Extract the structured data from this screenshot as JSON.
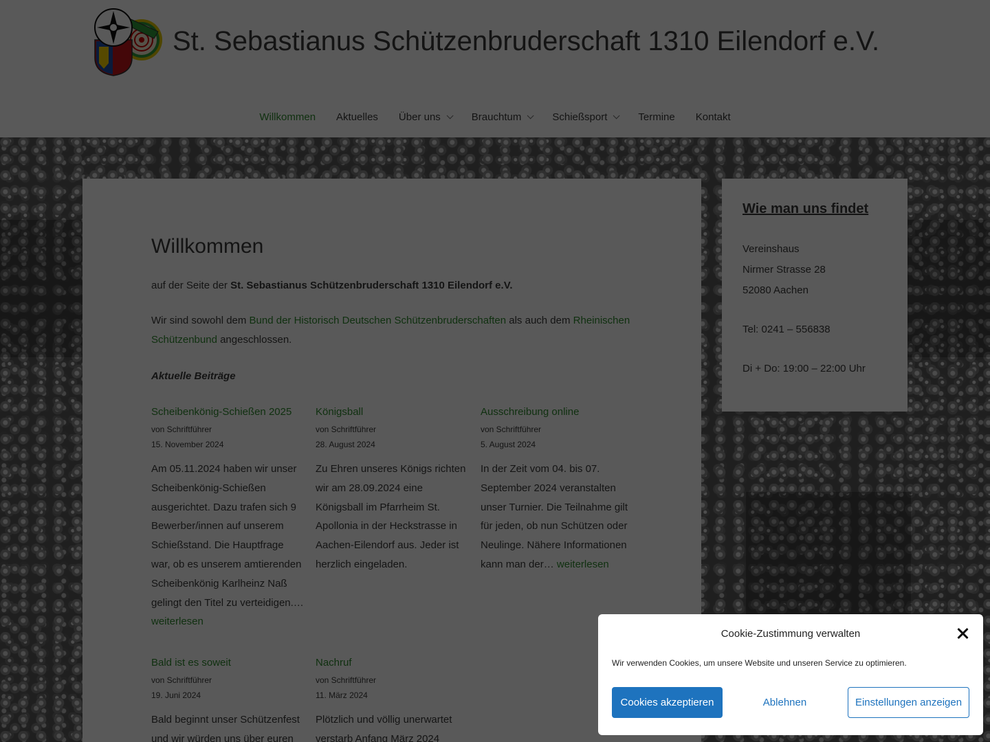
{
  "header": {
    "site_title": "St. Sebastianus Schützenbruderschaft 1310 Eilendorf e.V.",
    "logo_icon": "club-crest-icon"
  },
  "nav": {
    "items": [
      {
        "label": "Willkommen",
        "active": true,
        "has_submenu": false
      },
      {
        "label": "Aktuelles",
        "active": false,
        "has_submenu": false
      },
      {
        "label": "Über uns",
        "active": false,
        "has_submenu": true
      },
      {
        "label": "Brauchtum",
        "active": false,
        "has_submenu": true
      },
      {
        "label": "Schießsport",
        "active": false,
        "has_submenu": true
      },
      {
        "label": "Termine",
        "active": false,
        "has_submenu": false
      },
      {
        "label": "Kontakt",
        "active": false,
        "has_submenu": false
      }
    ]
  },
  "main": {
    "title": "Willkommen",
    "intro_prefix": "auf der Seite der ",
    "intro_bold": "St. Sebastianus Schützenbruderschaft 1310 Eilendorf e.V.",
    "para_1": "Wir sind sowohl dem ",
    "link_1": "Bund der Historisch Deutschen Schützenbruderschaften",
    "para_2": " als auch dem ",
    "link_2": "Rheinischen Schützenbund",
    "para_3": " angeschlossen.",
    "section_label": "Aktuelle Beiträge",
    "read_more": "weiterlesen",
    "posts": [
      {
        "title": "Scheibenkönig-Schießen 2025",
        "author": "von Schriftführer",
        "date": "15. November 2024",
        "excerpt": "Am 05.11.2024 haben wir unser Scheibenkönig-Schießen ausgerichtet. Dazu trafen sich 9 Bewerber/innen auf unserem Schießstand. Die Hauptfrage war, ob es unserem amtierenden Scheibenkönig Karlheinz Naß gelingt den Titel zu verteidigen.…"
      },
      {
        "title": "Königsball",
        "author": "von Schriftführer",
        "date": "28. August 2024",
        "excerpt": "Zu Ehren unseres Königs richten wir am 28.09.2024 eine Königsball im Pfarrheim St. Apollonia in der Heckstrasse in Aachen-Eilendorf aus. Jeder ist herzlich eingeladen."
      },
      {
        "title": "Ausschreibung online",
        "author": "von Schriftführer",
        "date": "5. August 2024",
        "excerpt": "In der Zeit vom 04. bis 07. September 2024 veranstalten unser Turnier. Die Teilnahme gilt für jeden, ob nun Schützen oder Neulinge. Nähere Informationen kann man der…"
      },
      {
        "title": "Bald ist es soweit",
        "author": "von Schriftführer",
        "date": "19. Juni 2024",
        "excerpt": "Bald beginnt unser Schützenfest und wir würden uns über euren"
      },
      {
        "title": "Nachruf",
        "author": "von Schriftführer",
        "date": "11. März 2024",
        "excerpt": "Plötzlich und völlig unerwartet verstarb Anfang März 2024"
      }
    ]
  },
  "sidebar": {
    "widget_title": "Wie man uns findet",
    "address_1": "Vereinshaus",
    "address_2": "Nirmer Strasse 28",
    "address_3": "52080 Aachen",
    "phone": "Tel: 0241 – 556838",
    "hours": "Di + Do: 19:00 – 22:00 Uhr"
  },
  "cookie": {
    "title": "Cookie-Zustimmung verwalten",
    "text": "Wir verwenden Cookies, um unsere Website und unseren Service zu optimieren.",
    "accept": "Cookies akzeptieren",
    "deny": "Ablehnen",
    "settings": "Einstellungen anzeigen",
    "close_icon": "close-icon"
  },
  "colors": {
    "link": "#2e8b2e",
    "button_primary": "#1e73be",
    "overlay": "rgba(0,0,0,0.65)"
  }
}
